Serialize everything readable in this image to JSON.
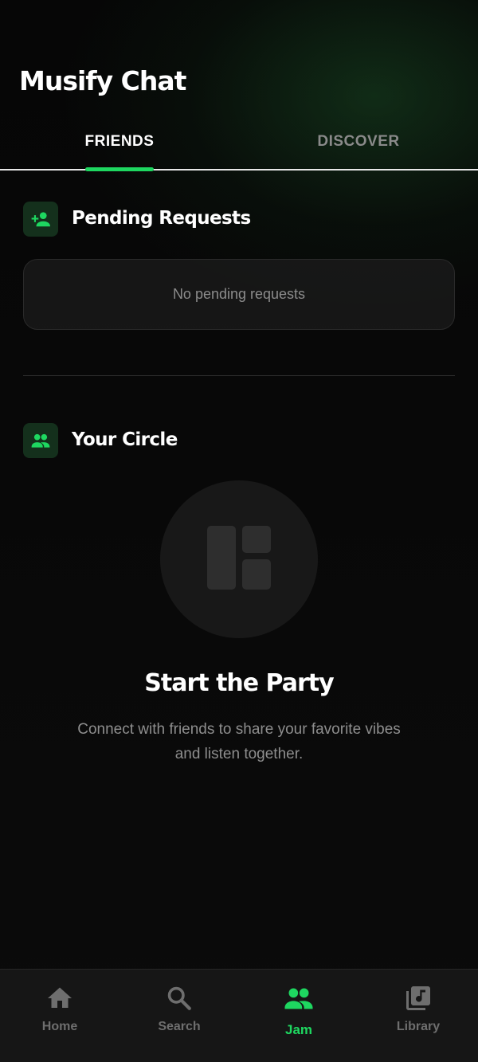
{
  "app": {
    "title": "Musify Chat",
    "accent_color": "#1ed760"
  },
  "tabs": [
    {
      "label": "FRIENDS",
      "active": true
    },
    {
      "label": "DISCOVER",
      "active": false
    }
  ],
  "pending": {
    "icon": "person-add-icon",
    "title": "Pending Requests",
    "empty_text": "No pending requests"
  },
  "circle": {
    "icon": "group-icon",
    "title": "Your Circle",
    "empty_icon": "dashboard-icon",
    "empty_title": "Start the Party",
    "empty_description": "Connect with friends to share your favorite vibes and listen together."
  },
  "bottom_nav": [
    {
      "label": "Home",
      "icon": "home-icon",
      "active": false
    },
    {
      "label": "Search",
      "icon": "search-icon",
      "active": false
    },
    {
      "label": "Jam",
      "icon": "group-icon",
      "active": true
    },
    {
      "label": "Library",
      "icon": "library-music-icon",
      "active": false
    }
  ]
}
